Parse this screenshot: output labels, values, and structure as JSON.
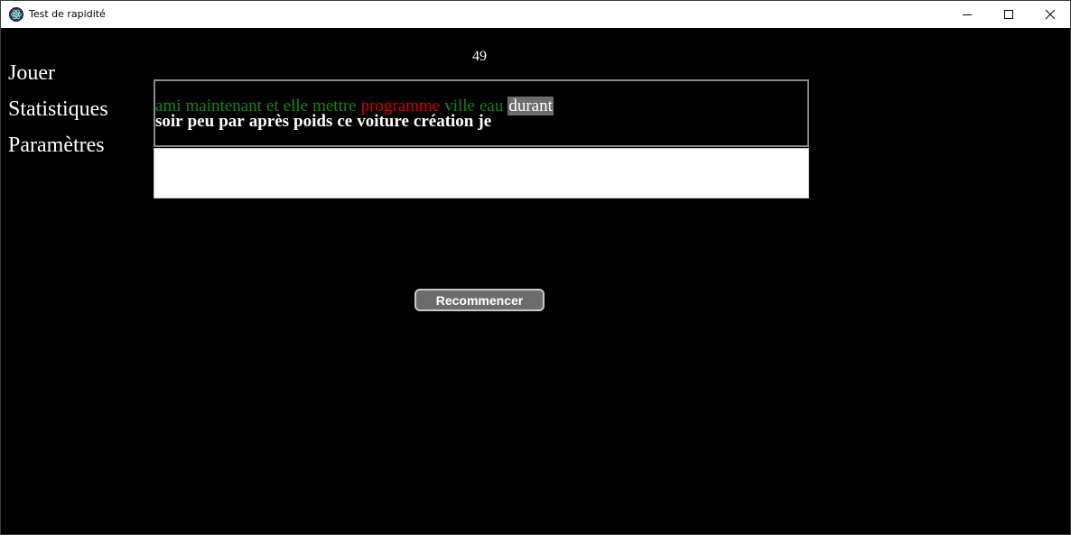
{
  "window": {
    "title": "Test de rapidité",
    "icon": "electron-app-icon",
    "controls": [
      "minimize-icon",
      "maximize-icon",
      "close-icon"
    ]
  },
  "menu": {
    "items": [
      {
        "label": "Jouer"
      },
      {
        "label": "Statistiques"
      },
      {
        "label": "Paramètres"
      }
    ]
  },
  "timer": {
    "value": "49"
  },
  "words": {
    "line1": [
      {
        "text": "ami",
        "status": "correct"
      },
      {
        "text": "maintenant",
        "status": "correct"
      },
      {
        "text": "et",
        "status": "correct"
      },
      {
        "text": "elle",
        "status": "correct"
      },
      {
        "text": "mettre",
        "status": "correct"
      },
      {
        "text": "programme",
        "status": "wrong"
      },
      {
        "text": "ville",
        "status": "correct"
      },
      {
        "text": "eau",
        "status": "correct"
      },
      {
        "text": "durant",
        "status": "current"
      }
    ],
    "line2": [
      "soir",
      "peu",
      "par",
      "après",
      "poids",
      "ce",
      "voiture",
      "création",
      "je"
    ]
  },
  "input": {
    "value": "",
    "placeholder": ""
  },
  "restart": {
    "label": "Recommencer"
  },
  "colors": {
    "background": "#000000",
    "correct": "#108a10",
    "wrong": "#e00000",
    "current_highlight": "#6d6d6d",
    "button": "#6c6c6c"
  }
}
